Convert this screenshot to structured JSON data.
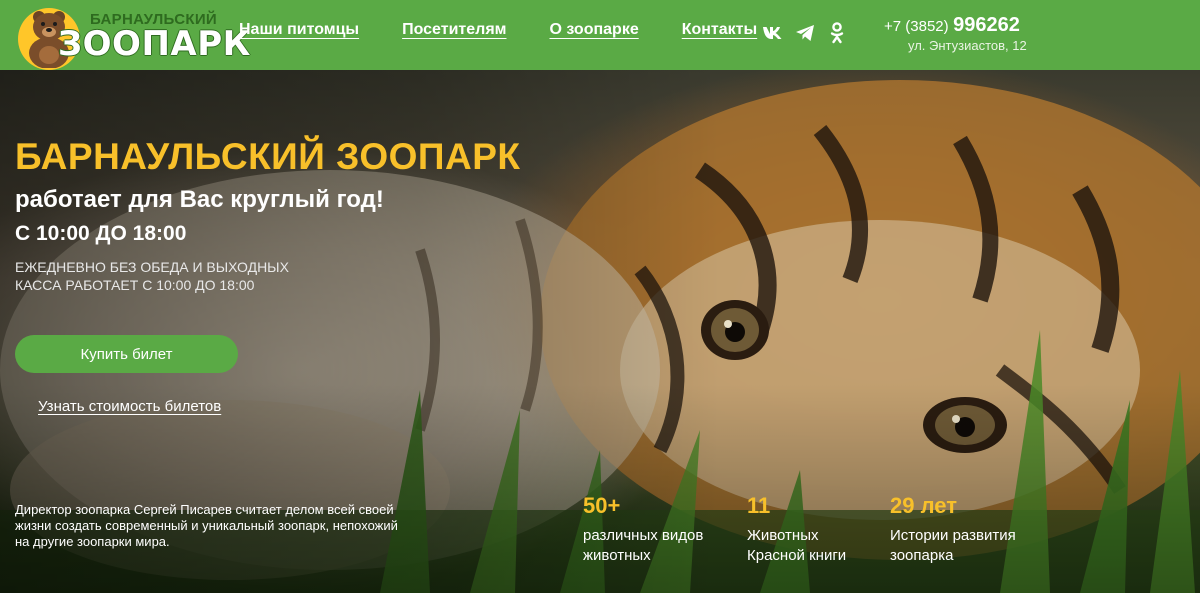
{
  "header": {
    "logo": {
      "small_text": "БАРНАУЛЬСКИЙ",
      "big_text": "ЗООПАРК"
    },
    "nav": [
      {
        "label": "Наши питомцы"
      },
      {
        "label": "Посетителям"
      },
      {
        "label": "О зоопарке"
      },
      {
        "label": "Контакты"
      }
    ],
    "social": [
      "vk-icon",
      "telegram-icon",
      "odnoklassniki-icon"
    ],
    "contact": {
      "phone_prefix": "+7 (3852)",
      "phone_main": "996262",
      "address": "ул. Энтузиастов, 12"
    }
  },
  "hero": {
    "title": "БАРНАУЛЬСКИЙ ЗООПАРК",
    "subtitle": "работает для Вас круглый год!",
    "hours": "С 10:00 ДО 18:00",
    "note_line1": "ЕЖЕДНЕВНО БЕЗ ОБЕДА И ВЫХОДНЫХ",
    "note_line2": "КАССА РАБОТАЕТ С 10:00 ДО 18:00",
    "buy_button": "Купить билет",
    "price_link": "Узнать стоимость билетов",
    "director_text": "Директор зоопарка Сергей Писарев считает делом всей своей жизни создать современный и уникальный зоопарк, непохожий на другие зоопарки мира.",
    "stats": [
      {
        "number": "50+",
        "line1": "различных видов",
        "line2": "животных"
      },
      {
        "number": "11",
        "line1": "Животных",
        "line2": "Красной книги"
      },
      {
        "number": "29 лет",
        "line1": "Истории развития",
        "line2": "зоопарка"
      }
    ]
  },
  "colors": {
    "header_green": "#5aaa45",
    "accent_yellow": "#f8c02a",
    "button_green": "#5aaa45"
  }
}
